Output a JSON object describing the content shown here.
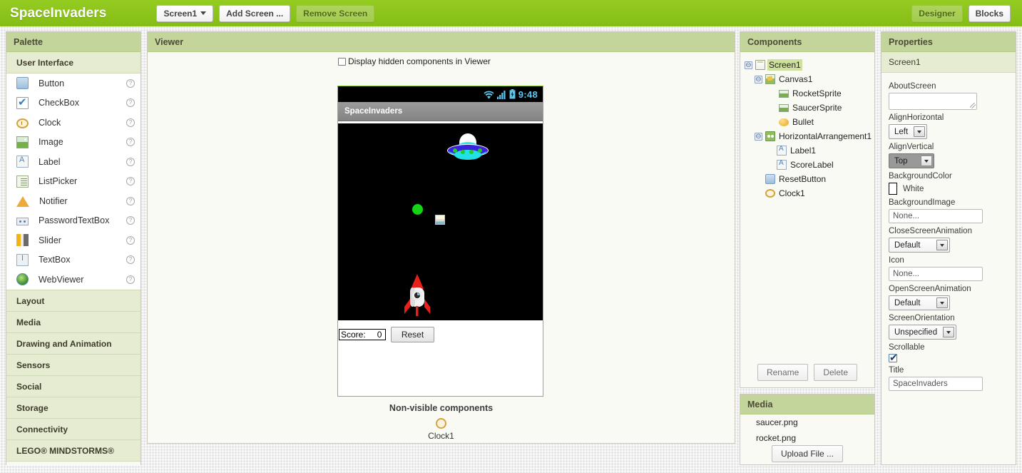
{
  "topbar": {
    "app_title": "SpaceInvaders",
    "screen_selector": "Screen1",
    "add_screen": "Add Screen ...",
    "remove_screen": "Remove Screen",
    "designer": "Designer",
    "blocks": "Blocks"
  },
  "palette": {
    "header": "Palette",
    "sections": [
      {
        "label": "User Interface",
        "open": true
      },
      {
        "label": "Layout",
        "open": false
      },
      {
        "label": "Media",
        "open": false
      },
      {
        "label": "Drawing and Animation",
        "open": false
      },
      {
        "label": "Sensors",
        "open": false
      },
      {
        "label": "Social",
        "open": false
      },
      {
        "label": "Storage",
        "open": false
      },
      {
        "label": "Connectivity",
        "open": false
      },
      {
        "label": "LEGO® MINDSTORMS®",
        "open": false
      }
    ],
    "items": [
      {
        "label": "Button",
        "icon": "button-icon"
      },
      {
        "label": "CheckBox",
        "icon": "checkbox-icon"
      },
      {
        "label": "Clock",
        "icon": "clock-icon"
      },
      {
        "label": "Image",
        "icon": "image-icon"
      },
      {
        "label": "Label",
        "icon": "label-icon"
      },
      {
        "label": "ListPicker",
        "icon": "listpicker-icon"
      },
      {
        "label": "Notifier",
        "icon": "notifier-icon"
      },
      {
        "label": "PasswordTextBox",
        "icon": "password-icon"
      },
      {
        "label": "Slider",
        "icon": "slider-icon"
      },
      {
        "label": "TextBox",
        "icon": "textbox-icon"
      },
      {
        "label": "WebViewer",
        "icon": "webviewer-icon"
      }
    ],
    "help_glyph": "?"
  },
  "viewer": {
    "header": "Viewer",
    "hidden_components_label": "Display hidden components in Viewer",
    "hidden_components_checked": false,
    "phone": {
      "status_time": "9:48",
      "title": "SpaceInvaders",
      "score_label": "Score:",
      "score_value": "0",
      "reset_button": "Reset"
    },
    "nonvisible_title": "Non-visible components",
    "nonvisible_items": [
      {
        "label": "Clock1",
        "icon": "clock-icon"
      }
    ]
  },
  "components": {
    "header": "Components",
    "tree": [
      {
        "label": "Screen1",
        "depth": 0,
        "expander": "⊖",
        "icon": "screen-icon",
        "selected": true
      },
      {
        "label": "Canvas1",
        "depth": 1,
        "expander": "⊖",
        "icon": "canvas-icon",
        "selected": false
      },
      {
        "label": "RocketSprite",
        "depth": 2,
        "expander": "",
        "icon": "sprite-icon",
        "selected": false
      },
      {
        "label": "SaucerSprite",
        "depth": 2,
        "expander": "",
        "icon": "sprite-icon",
        "selected": false
      },
      {
        "label": "Bullet",
        "depth": 2,
        "expander": "",
        "icon": "ball-icon",
        "selected": false
      },
      {
        "label": "HorizontalArrangement1",
        "depth": 1,
        "expander": "⊖",
        "icon": "harr-icon",
        "selected": false
      },
      {
        "label": "Label1",
        "depth": 2,
        "expander": "",
        "icon": "label-icon",
        "selected": false
      },
      {
        "label": "ScoreLabel",
        "depth": 2,
        "expander": "",
        "icon": "label-icon",
        "selected": false
      },
      {
        "label": "ResetButton",
        "depth": 1,
        "expander": "",
        "icon": "button-icon",
        "selected": false
      },
      {
        "label": "Clock1",
        "depth": 1,
        "expander": "",
        "icon": "clock-icon",
        "selected": false
      }
    ],
    "rename_button": "Rename",
    "delete_button": "Delete"
  },
  "media": {
    "header": "Media",
    "files": [
      "saucer.png",
      "rocket.png"
    ],
    "upload_button": "Upload File ..."
  },
  "properties": {
    "header": "Properties",
    "selected_component": "Screen1",
    "fields": [
      {
        "name": "AboutScreen",
        "type": "textarea",
        "value": ""
      },
      {
        "name": "AlignHorizontal",
        "type": "select",
        "value": "Left",
        "focused": false
      },
      {
        "name": "AlignVertical",
        "type": "select",
        "value": "Top",
        "focused": true
      },
      {
        "name": "BackgroundColor",
        "type": "color",
        "value": "White",
        "swatch": "#FFFFFF"
      },
      {
        "name": "BackgroundImage",
        "type": "text",
        "value": "None..."
      },
      {
        "name": "CloseScreenAnimation",
        "type": "select",
        "value": "Default",
        "focused": false
      },
      {
        "name": "Icon",
        "type": "text",
        "value": "None..."
      },
      {
        "name": "OpenScreenAnimation",
        "type": "select",
        "value": "Default",
        "focused": false
      },
      {
        "name": "ScreenOrientation",
        "type": "select",
        "value": "Unspecified",
        "focused": false
      },
      {
        "name": "Scrollable",
        "type": "checkbox",
        "value": "",
        "checked": true
      },
      {
        "name": "Title",
        "type": "text",
        "value": "SpaceInvaders"
      }
    ]
  },
  "colors": {
    "brand_green": "#8ac41c",
    "panel_header": "#c3d59b",
    "section_bg": "#e6ecd2",
    "status_cyan": "#5cc7ef",
    "bullet_green": "#14d514",
    "canvas_black": "#000000"
  }
}
